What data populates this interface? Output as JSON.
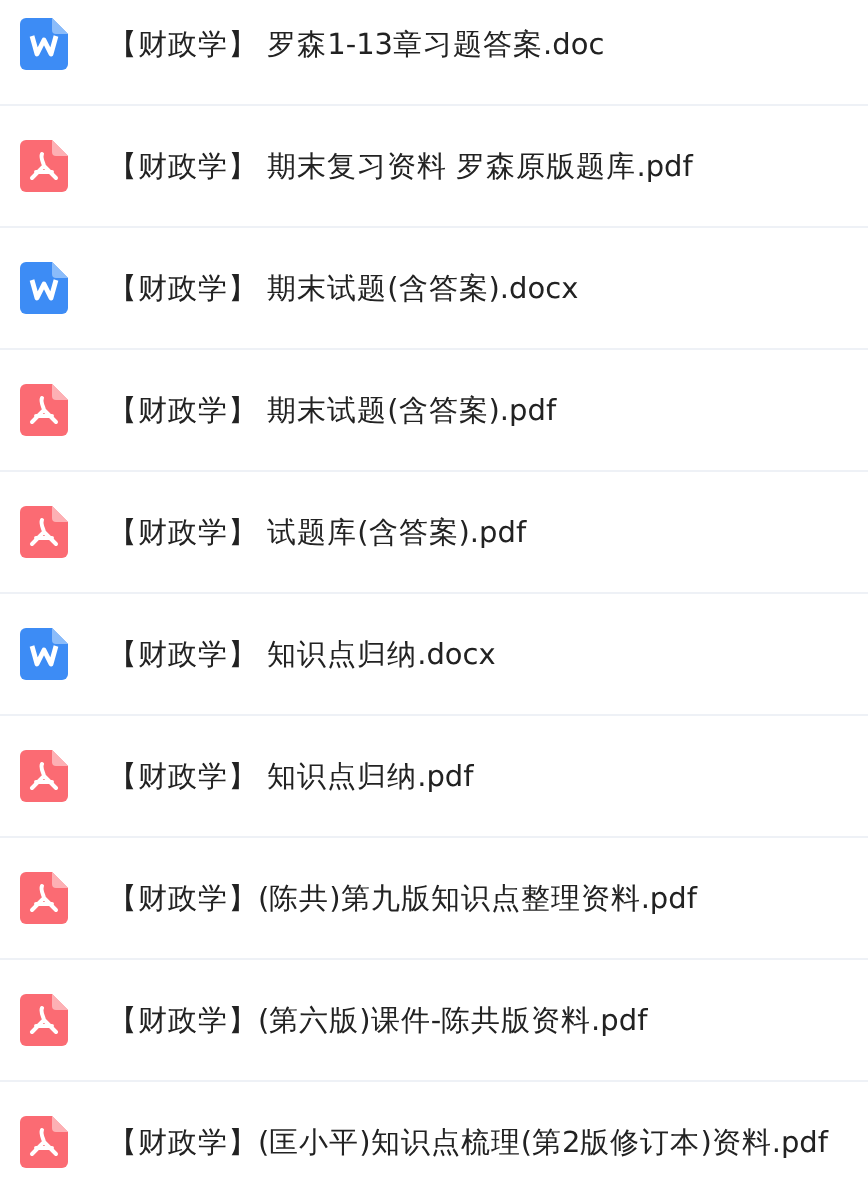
{
  "files": [
    {
      "kind": "word",
      "name": "【财政学】 罗森1-13章习题答案.doc"
    },
    {
      "kind": "pdf",
      "name": "【财政学】 期末复习资料 罗森原版题库.pdf"
    },
    {
      "kind": "word",
      "name": "【财政学】 期末试题(含答案).docx"
    },
    {
      "kind": "pdf",
      "name": "【财政学】 期末试题(含答案).pdf"
    },
    {
      "kind": "pdf",
      "name": "【财政学】 试题库(含答案).pdf"
    },
    {
      "kind": "word",
      "name": "【财政学】 知识点归纳.docx"
    },
    {
      "kind": "pdf",
      "name": "【财政学】 知识点归纳.pdf"
    },
    {
      "kind": "pdf",
      "name": "【财政学】(陈共)第九版知识点整理资料.pdf"
    },
    {
      "kind": "pdf",
      "name": "【财政学】(第六版)课件-陈共版资料.pdf"
    },
    {
      "kind": "pdf",
      "name": "【财政学】(匡小平)知识点梳理(第2版修订本)资料.pdf"
    }
  ]
}
